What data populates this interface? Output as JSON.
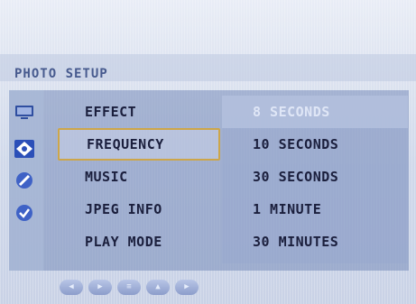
{
  "menu": {
    "title": "PHOTO SETUP"
  },
  "icons": [
    {
      "name": "monitor-icon",
      "glyph": "▭",
      "color": "#2f4ea0"
    },
    {
      "name": "photo-icon",
      "glyph": "◆",
      "color": "#2b4fb8"
    },
    {
      "name": "settings-icon",
      "glyph": "⊘",
      "color": "#3f62c6"
    },
    {
      "name": "check-icon",
      "glyph": "✓",
      "color": "#3f62c6"
    }
  ],
  "items": [
    {
      "label": "EFFECT",
      "selected": false
    },
    {
      "label": "FREQUENCY",
      "selected": true
    },
    {
      "label": "MUSIC",
      "selected": false
    },
    {
      "label": "JPEG INFO",
      "selected": false
    },
    {
      "label": "PLAY MODE",
      "selected": false
    }
  ],
  "options": [
    {
      "label": "8 SECONDS",
      "highlighted": true
    },
    {
      "label": "10 SECONDS",
      "highlighted": false
    },
    {
      "label": "30 SECONDS",
      "highlighted": false
    },
    {
      "label": "1 MINUTE",
      "highlighted": false
    },
    {
      "label": "30 MINUTES",
      "highlighted": false
    }
  ],
  "bottom_nav": [
    {
      "name": "nav-left-button",
      "glyph": "◀"
    },
    {
      "name": "nav-play-button",
      "glyph": "▶"
    },
    {
      "name": "nav-menu-button",
      "glyph": "≡"
    },
    {
      "name": "nav-up-button",
      "glyph": "▲"
    },
    {
      "name": "nav-right-button",
      "glyph": "▶"
    }
  ],
  "colors": {
    "accent": "#cda64a",
    "text": "#1b1f3d",
    "title": "#475a8e"
  }
}
